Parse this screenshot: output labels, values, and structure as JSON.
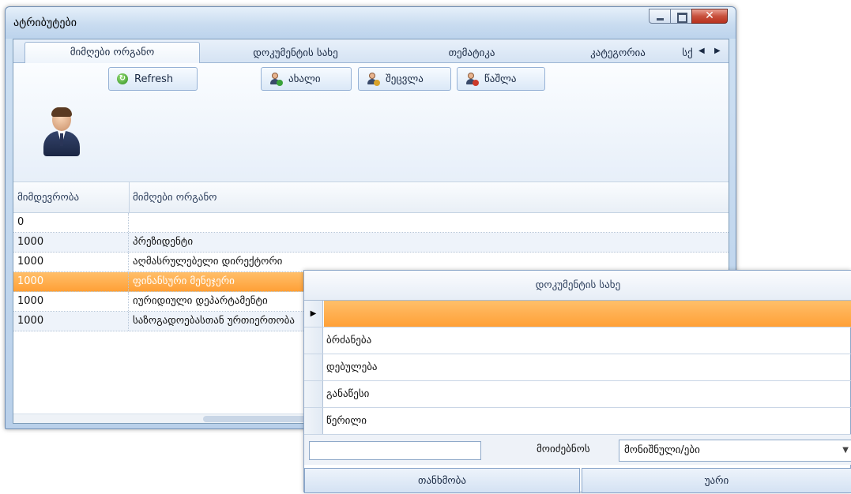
{
  "window": {
    "title": "ატრიბუტები",
    "tabs": [
      {
        "label": "მიმღები ორგანო",
        "active": true
      },
      {
        "label": "დოკუმენტის სახე",
        "active": false
      },
      {
        "label": "თემატიკა",
        "active": false
      },
      {
        "label": "კატეგორია",
        "active": false
      },
      {
        "label": "სქ",
        "active": false
      }
    ],
    "toolbar": {
      "refresh_label": "Refresh",
      "new_label": "ახალი",
      "edit_label": "შეცვლა",
      "delete_label": "წაშლა"
    },
    "grid": {
      "columns": [
        "მიმდევრობა",
        "მიმღები ორგანო"
      ],
      "rows": [
        {
          "order": "0",
          "name": ""
        },
        {
          "order": "1000",
          "name": "პრეზიდენტი"
        },
        {
          "order": "1000",
          "name": "აღმასრულებელი დირექტორი"
        },
        {
          "order": "1000",
          "name": "ფინანსური მენეჯერი",
          "selected": true
        },
        {
          "order": "1000",
          "name": "იურიდიული დეპარტამენტი"
        },
        {
          "order": "1000",
          "name": "საზოგადოებასთან ურთიერთობა"
        }
      ]
    }
  },
  "popup": {
    "header": "დოკუმენტის სახე",
    "items": [
      "",
      "ბრძანება",
      "დებულება",
      "განაწესი",
      "წერილი"
    ],
    "search_label": "მოიძებნოს",
    "search_value": "",
    "search_field_value": "მონიშნული/ები",
    "ok_label": "თანხმობა",
    "cancel_label": "უარი"
  },
  "colors": {
    "selection": "#ffa037",
    "accent": "#9cb5d4"
  }
}
